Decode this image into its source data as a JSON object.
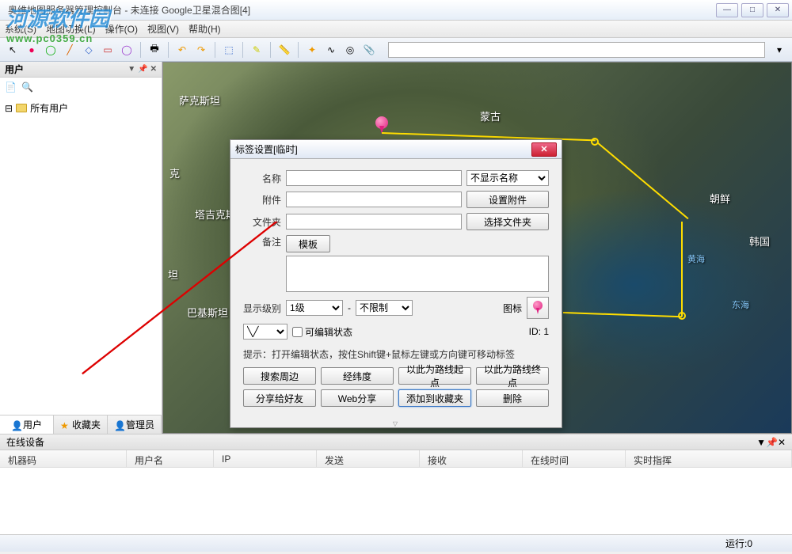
{
  "window": {
    "title": "奥维地图服务器管理控制台 - 未连接   Google卫星混合图[4]"
  },
  "menu": {
    "system": "系统(S)",
    "map_switch": "地图切换(L)",
    "operate": "操作(O)",
    "view": "视图(V)",
    "help": "帮助(H)"
  },
  "sidebar": {
    "title": "用户",
    "tree_root": "所有用户",
    "tabs": {
      "user": "用户",
      "fav": "收藏夹",
      "admin": "管理员"
    }
  },
  "map_labels": {
    "kazakhstan": "萨克斯坦",
    "mongolia": "蒙古",
    "tajikistan": "塔吉克斯坦",
    "ke": "克",
    "tan": "坦",
    "pakistan": "巴基斯坦",
    "north_korea": "朝鲜",
    "south_korea": "韩国",
    "yellow_sea": "黄海",
    "east_sea": "东海"
  },
  "dialog": {
    "title": "标签设置[临时]",
    "labels": {
      "name": "名称",
      "attachment": "附件",
      "folder": "文件夹",
      "remark": "备注",
      "level": "显示级别",
      "icon": "图标"
    },
    "name_display_option": "不显示名称",
    "set_attachment": "设置附件",
    "select_folder": "选择文件夹",
    "template": "模板",
    "level_from": "1级",
    "level_to": "不限制",
    "editable": "可编辑状态",
    "id_label": "ID: 1",
    "hint": "提示：打开编辑状态，按住Shift键+鼠标左键或方向键可移动标签",
    "buttons": {
      "search_around": "搜索周边",
      "coords": "经纬度",
      "route_start": "以此为路线起点",
      "route_end": "以此为路线终点",
      "share_friend": "分享给好友",
      "web_share": "Web分享",
      "add_fav": "添加到收藏夹",
      "delete": "删除"
    }
  },
  "bottom": {
    "title": "在线设备",
    "cols": {
      "machine": "机器码",
      "user": "用户名",
      "ip": "IP",
      "send": "发送",
      "recv": "接收",
      "online_time": "在线时间",
      "realtime": "实时指挥"
    }
  },
  "status": {
    "run": "运行:0"
  },
  "watermark": {
    "line1": "河源软件园",
    "line2": "www.pc0359.cn"
  }
}
